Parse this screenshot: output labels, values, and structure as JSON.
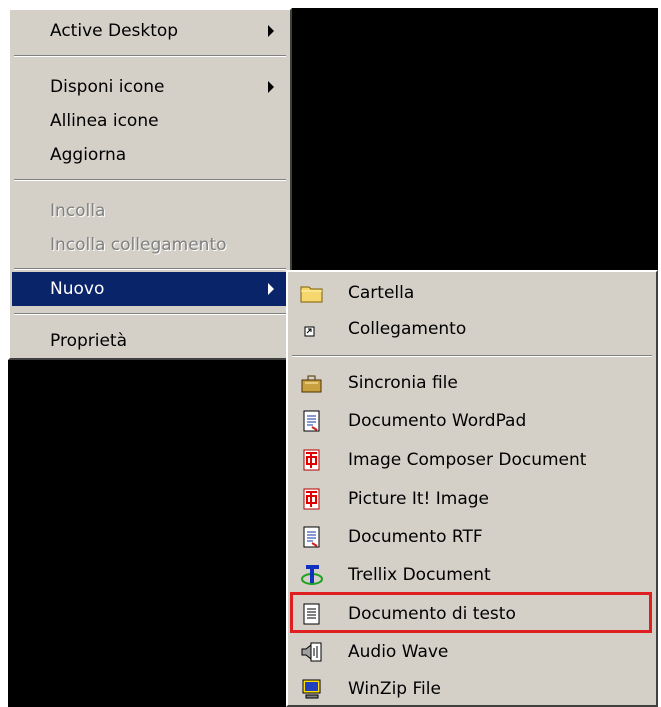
{
  "context_menu": {
    "items": [
      {
        "label": "Active Desktop",
        "has_submenu": true
      },
      {
        "label": "Disponi icone",
        "has_submenu": true
      },
      {
        "label": "Allinea icone"
      },
      {
        "label": "Aggiorna"
      },
      {
        "label": "Incolla",
        "disabled": true
      },
      {
        "label": "Incolla collegamento",
        "disabled": true
      },
      {
        "label": "Nuovo",
        "has_submenu": true,
        "selected": true
      },
      {
        "label": "Proprietà"
      }
    ]
  },
  "submenu_nuovo": {
    "items": [
      {
        "label": "Cartella",
        "icon": "folder-icon"
      },
      {
        "label": "Collegamento",
        "icon": "shortcut-icon"
      },
      {
        "label": "Sincronia file",
        "icon": "briefcase-icon"
      },
      {
        "label": "Documento WordPad",
        "icon": "wordpad-document-icon"
      },
      {
        "label": "Image Composer Document",
        "icon": "image-composer-icon"
      },
      {
        "label": "Picture It! Image",
        "icon": "picture-it-icon"
      },
      {
        "label": "Documento RTF",
        "icon": "rtf-document-icon"
      },
      {
        "label": "Trellix Document",
        "icon": "trellix-icon"
      },
      {
        "label": "Documento di testo",
        "icon": "text-document-icon",
        "highlighted": true
      },
      {
        "label": "Audio Wave",
        "icon": "audio-wave-icon"
      },
      {
        "label": "WinZip File",
        "icon": "winzip-icon"
      }
    ]
  },
  "colors": {
    "menu_background": "#d4d0c8",
    "selection": "#0a246a",
    "desktop": "#000000",
    "highlight_box": "#e02020"
  }
}
